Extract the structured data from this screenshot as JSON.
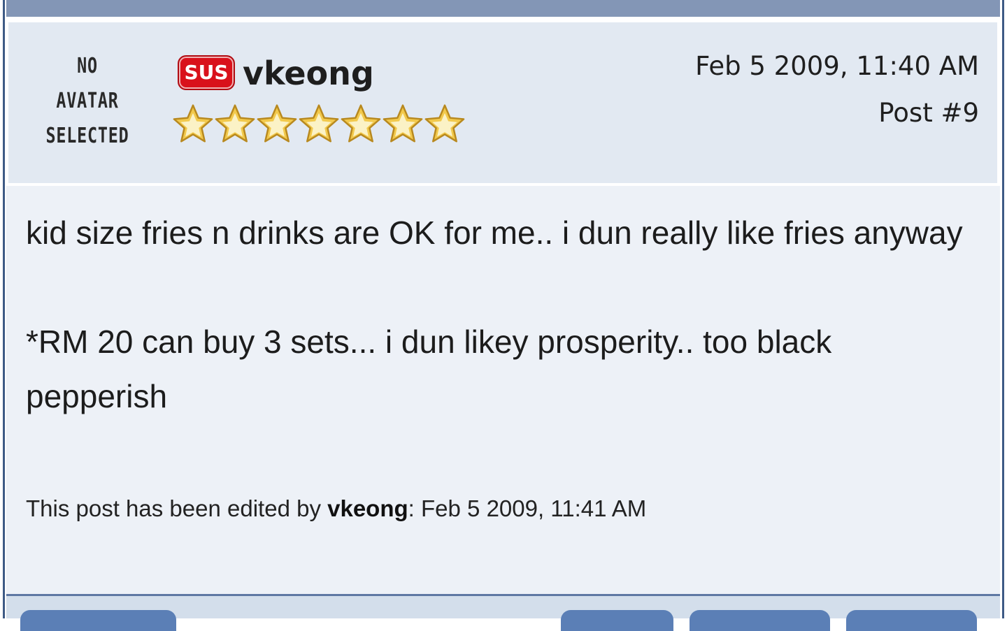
{
  "post": {
    "avatar_text_line1": "NO AVATAR",
    "avatar_text_line2": "SELECTED",
    "badge": "SUS",
    "username": "vkeong",
    "rating_stars": 7,
    "date": "Feb 5 2009, 11:40 AM",
    "post_number": "Post #9",
    "body_lines": [
      "kid size fries n drinks are OK for me.. i dun really like fries anyway",
      "*RM 20 can buy 3 sets... i dun likey prosperity.. too black",
      "pepperish"
    ],
    "edit_note": {
      "prefix": "This post has been edited by ",
      "editor": "vkeong",
      "suffix": ": Feb 5 2009, 11:41 AM"
    }
  },
  "colors": {
    "header_bg": "#e2e9f2",
    "body_bg": "#edf1f7",
    "badge_red": "#d9111b",
    "star_gold": "#f2c94c",
    "frame_blue": "#3e5a85",
    "button_blue": "#5b7fb6"
  },
  "icons": {
    "star": "star-icon"
  }
}
